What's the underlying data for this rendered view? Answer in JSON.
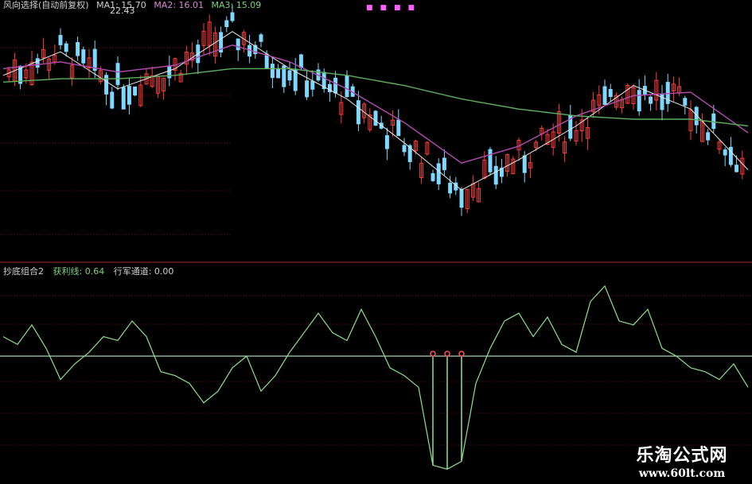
{
  "top_panel": {
    "legend_name": "风向选择(自动前复权)",
    "legend_ma1": "MA1: 15.70",
    "legend_ma2": "MA2: 16.01",
    "legend_ma3": "MA3: 15.09",
    "price_high_label": "22.43"
  },
  "bottom_panel": {
    "indicator_name": "抄底组合2",
    "series1_label": "获利线: 0.64",
    "series2_label": "行军通道: 0.00"
  },
  "watermark": {
    "title": "乐淘公式网",
    "url": "www.60lt.com"
  },
  "colors": {
    "background": "#000000",
    "candle_up": "#ff3b3b",
    "candle_down": "#7fd8ff",
    "ma1": "#e8e8e8",
    "ma2": "#b44cb4",
    "ma3": "#5fae5f",
    "indicator_line": "#8fe08f",
    "zero_line": "#b8e8c8",
    "signal_marker": "#ff5050",
    "grid": "#6a1010",
    "separator": "#8a2020"
  },
  "chart_data": [
    {
      "type": "candlestick",
      "title": "风向选择(自动前复权)",
      "series": [
        {
          "name": "MA1",
          "x": [
            0,
            10,
            20,
            30,
            40,
            50,
            60,
            70,
            80,
            90,
            100,
            110,
            120,
            130
          ],
          "values": [
            20.6,
            21.3,
            20.2,
            20.8,
            21.9,
            20.8,
            19.9,
            18.6,
            17.2,
            18.1,
            19.1,
            20.3,
            19.6,
            17.8
          ]
        },
        {
          "name": "MA2",
          "x": [
            0,
            10,
            20,
            30,
            40,
            50,
            60,
            70,
            80,
            90,
            100,
            110,
            120,
            130
          ],
          "values": [
            20.8,
            21.0,
            20.7,
            20.9,
            21.5,
            21.0,
            20.2,
            19.2,
            18.0,
            18.5,
            19.4,
            20.0,
            20.1,
            18.9
          ]
        },
        {
          "name": "MA3",
          "x": [
            0,
            10,
            20,
            30,
            40,
            50,
            60,
            70,
            80,
            90,
            100,
            110,
            120,
            130
          ],
          "values": [
            20.4,
            20.5,
            20.5,
            20.6,
            20.8,
            20.8,
            20.6,
            20.3,
            19.9,
            19.6,
            19.4,
            19.3,
            19.3,
            19.1
          ]
        }
      ],
      "annotations": [
        "22.43"
      ]
    },
    {
      "type": "line",
      "title": "抄底组合2",
      "series": [
        {
          "name": "获利线",
          "values": [
            0.5,
            0.3,
            0.8,
            0.2,
            -0.6,
            -0.2,
            0.1,
            0.5,
            0.4,
            0.9,
            0.5,
            -0.4,
            -0.5,
            -0.7,
            -1.2,
            -0.9,
            -0.3,
            0.0,
            -0.9,
            -0.5,
            0.1,
            0.6,
            1.1,
            0.6,
            0.4,
            1.2,
            0.5,
            -0.3,
            -0.5,
            -0.8,
            -2.8,
            -2.9,
            -2.7,
            -0.7,
            0.2,
            0.9,
            1.1,
            0.5,
            1.0,
            0.3,
            0.1,
            1.4,
            1.8,
            0.9,
            0.8,
            1.2,
            0.2,
            0.0,
            -0.3,
            -0.4,
            -0.6,
            -0.2,
            -0.8
          ]
        },
        {
          "name": "行军通道",
          "values": [
            0,
            0,
            0,
            0,
            0,
            0,
            0,
            0,
            0,
            0,
            0,
            0,
            0,
            0,
            0,
            0,
            0,
            0,
            0,
            0,
            0,
            0,
            0,
            0,
            0,
            0,
            0,
            0,
            0,
            0,
            0,
            0,
            0,
            0,
            0,
            0,
            0,
            0,
            0,
            0,
            0,
            0,
            0,
            0,
            0,
            0,
            0,
            0,
            0,
            0,
            0,
            0,
            0
          ]
        }
      ]
    }
  ]
}
